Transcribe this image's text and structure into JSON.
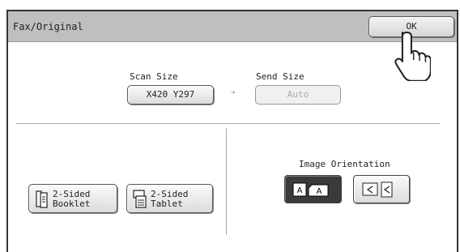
{
  "window": {
    "title": "Fax/Original"
  },
  "header": {
    "ok_label": "OK"
  },
  "scan_size": {
    "label": "Scan Size",
    "value": "X420 Y297"
  },
  "send_size": {
    "label": "Send Size",
    "value": "Auto"
  },
  "duplex": {
    "booklet": {
      "line1": "2-Sided",
      "line2": "Booklet"
    },
    "tablet": {
      "line1": "2-Sided",
      "line2": "Tablet"
    }
  },
  "orientation": {
    "label": "Image Orientation",
    "selected": "portrait",
    "options": [
      {
        "name": "portrait",
        "glyph": "A"
      },
      {
        "name": "landscape",
        "glyph": "A"
      }
    ]
  },
  "icons": [
    "pointing-hand-icon",
    "arrow-right-icon",
    "booklet-icon",
    "tablet-icon",
    "portrait-orientation-icon",
    "landscape-orientation-icon"
  ]
}
